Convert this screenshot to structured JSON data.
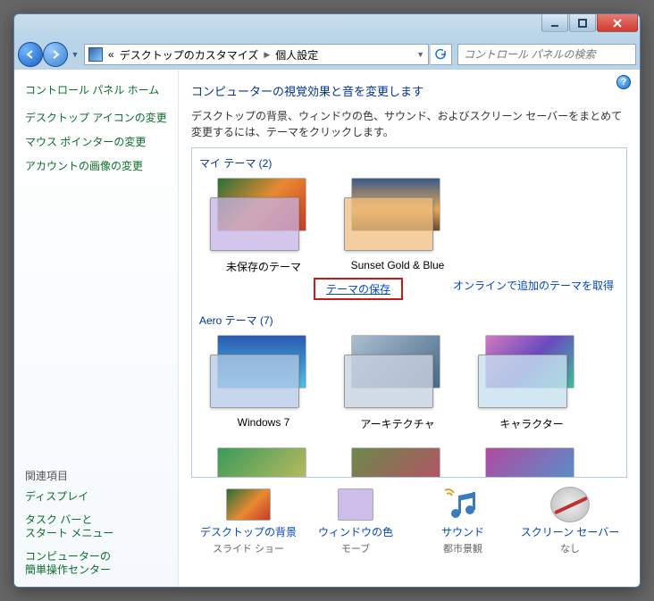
{
  "breadcrumb": {
    "chevrons": "«",
    "seg1": "デスクトップのカスタマイズ",
    "seg2": "個人設定"
  },
  "search": {
    "placeholder": "コントロール パネルの検索"
  },
  "sidebar": {
    "home": "コントロール パネル ホーム",
    "tasks": [
      "デスクトップ アイコンの変更",
      "マウス ポインターの変更",
      "アカウントの画像の変更"
    ],
    "related_header": "関連項目",
    "related": [
      "ディスプレイ",
      "タスク バーと\nスタート メニュー",
      "コンピューターの\n簡単操作センター"
    ]
  },
  "main": {
    "title": "コンピューターの視覚効果と音を変更します",
    "subtitle": "デスクトップの背景、ウィンドウの色、サウンド、およびスクリーン セーバーをまとめて変更するには、テーマをクリックします。",
    "groups": {
      "my_themes_hdr": "マイ テーマ (2)",
      "aero_hdr": "Aero テーマ (7)"
    },
    "themes": {
      "unsaved": "未保存のテーマ",
      "sunset": "Sunset Gold & Blue",
      "win7": "Windows 7",
      "arch": "アーキテクチャ",
      "char": "キャラクター"
    },
    "actions": {
      "save_theme": "テーマの保存",
      "get_online": "オンラインで追加のテーマを取得"
    },
    "bottom": {
      "bg": {
        "label": "デスクトップの背景",
        "value": "スライド ショー"
      },
      "color": {
        "label": "ウィンドウの色",
        "value": "モーブ"
      },
      "sound": {
        "label": "サウンド",
        "value": "都市景観"
      },
      "screensaver": {
        "label": "スクリーン セーバー",
        "value": "なし"
      }
    }
  }
}
